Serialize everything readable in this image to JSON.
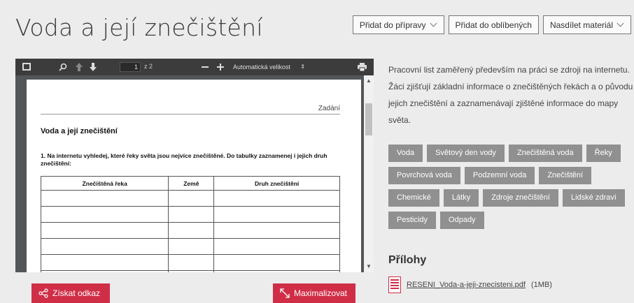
{
  "page": {
    "title": "Voda a její znečištění"
  },
  "actions": {
    "add_to_prep": "Přidat do přípravy",
    "add_favorites": "Přidat do oblíbených",
    "share": "Nasdílet materiál"
  },
  "viewer": {
    "page_current": "1",
    "page_count": "z 2",
    "zoom": "Automatická velikost",
    "document": {
      "header_label": "Zadání",
      "title": "Voda a její znečištění",
      "question": "1. Na internetu vyhledej, které řeky světa jsou nejvíce znečištěné. Do tabulky zaznamenej i jejich druh znečištění:",
      "table_headers": [
        "Znečištěná řeka",
        "Země",
        "Druh znečištění"
      ]
    }
  },
  "buttons": {
    "get_link": "Získat odkaz",
    "maximize": "Maximalizovat"
  },
  "description": "Pracovní list zaměřený především na práci se zdroji na internetu. Žáci zjišťují základní informace o znečištěných řekách a o původu jejich znečištění a zaznamenávají zjištěné informace do mapy světa.",
  "tags": [
    "Voda",
    "Světový den vody",
    "Znečištěná voda",
    "Řeky",
    "Povrchová voda",
    "Podzemní voda",
    "Znečištění",
    "Chemické",
    "Látky",
    "Zdroje znečištění",
    "Lidské zdraví",
    "Pesticidy",
    "Odpady"
  ],
  "attachments": {
    "title": "Přílohy",
    "items": [
      {
        "name": "RESENI_Voda-a-jeji-znecisteni.pdf",
        "size": "(1MB)"
      }
    ]
  },
  "colors": {
    "accent": "#d02e47",
    "tag": "#909090",
    "viewer_bg": "#525659"
  }
}
